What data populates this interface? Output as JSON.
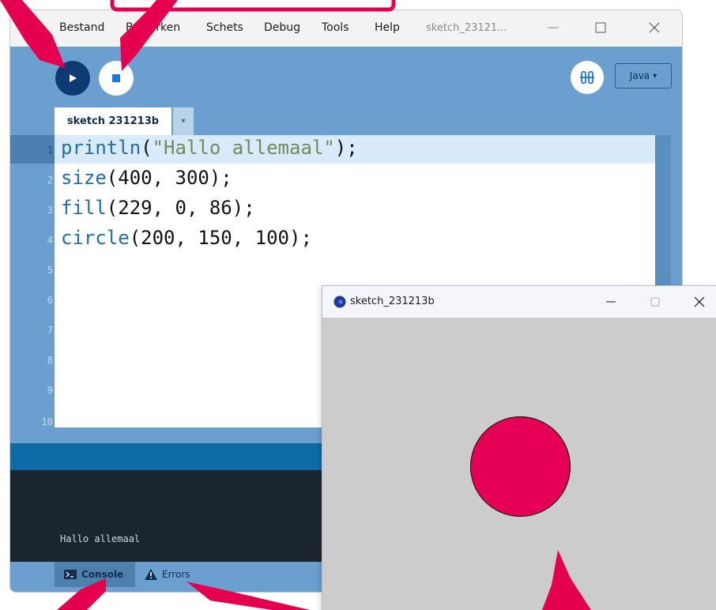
{
  "menu": [
    "Bestand",
    "Bewerken",
    "Schets",
    "Debug",
    "Tools",
    "Help"
  ],
  "window_title": "sketch_23121...",
  "toolbar": {
    "mode_label": "Java",
    "mode_arrow": "▾"
  },
  "tabs": {
    "active": "sketch 231213b",
    "menu_arrow": "▾"
  },
  "editor": {
    "line_numbers": [
      "1",
      "2",
      "3",
      "4",
      "5",
      "6",
      "7",
      "8",
      "9",
      "10"
    ],
    "code": [
      {
        "fn": "println",
        "open": "(",
        "str": "\"Hallo allemaal\"",
        "rest": ");"
      },
      {
        "fn": "size",
        "rest": "(400, 300);"
      },
      {
        "fn": "fill",
        "rest": "(229, 0, 86);"
      },
      {
        "fn": "circle",
        "rest": "(200, 150, 100);"
      }
    ]
  },
  "console": {
    "output": "Hallo allemaal"
  },
  "footer": {
    "console_tab": "Console",
    "errors_tab": "Errors"
  },
  "sketch_window": {
    "title": "sketch_231213b",
    "fill_color": "#e50056",
    "background": "#cccccc"
  },
  "colors": {
    "toolbar": "#6a9fcf",
    "run_button": "#0d3a73",
    "annotation": "#e5004f"
  }
}
